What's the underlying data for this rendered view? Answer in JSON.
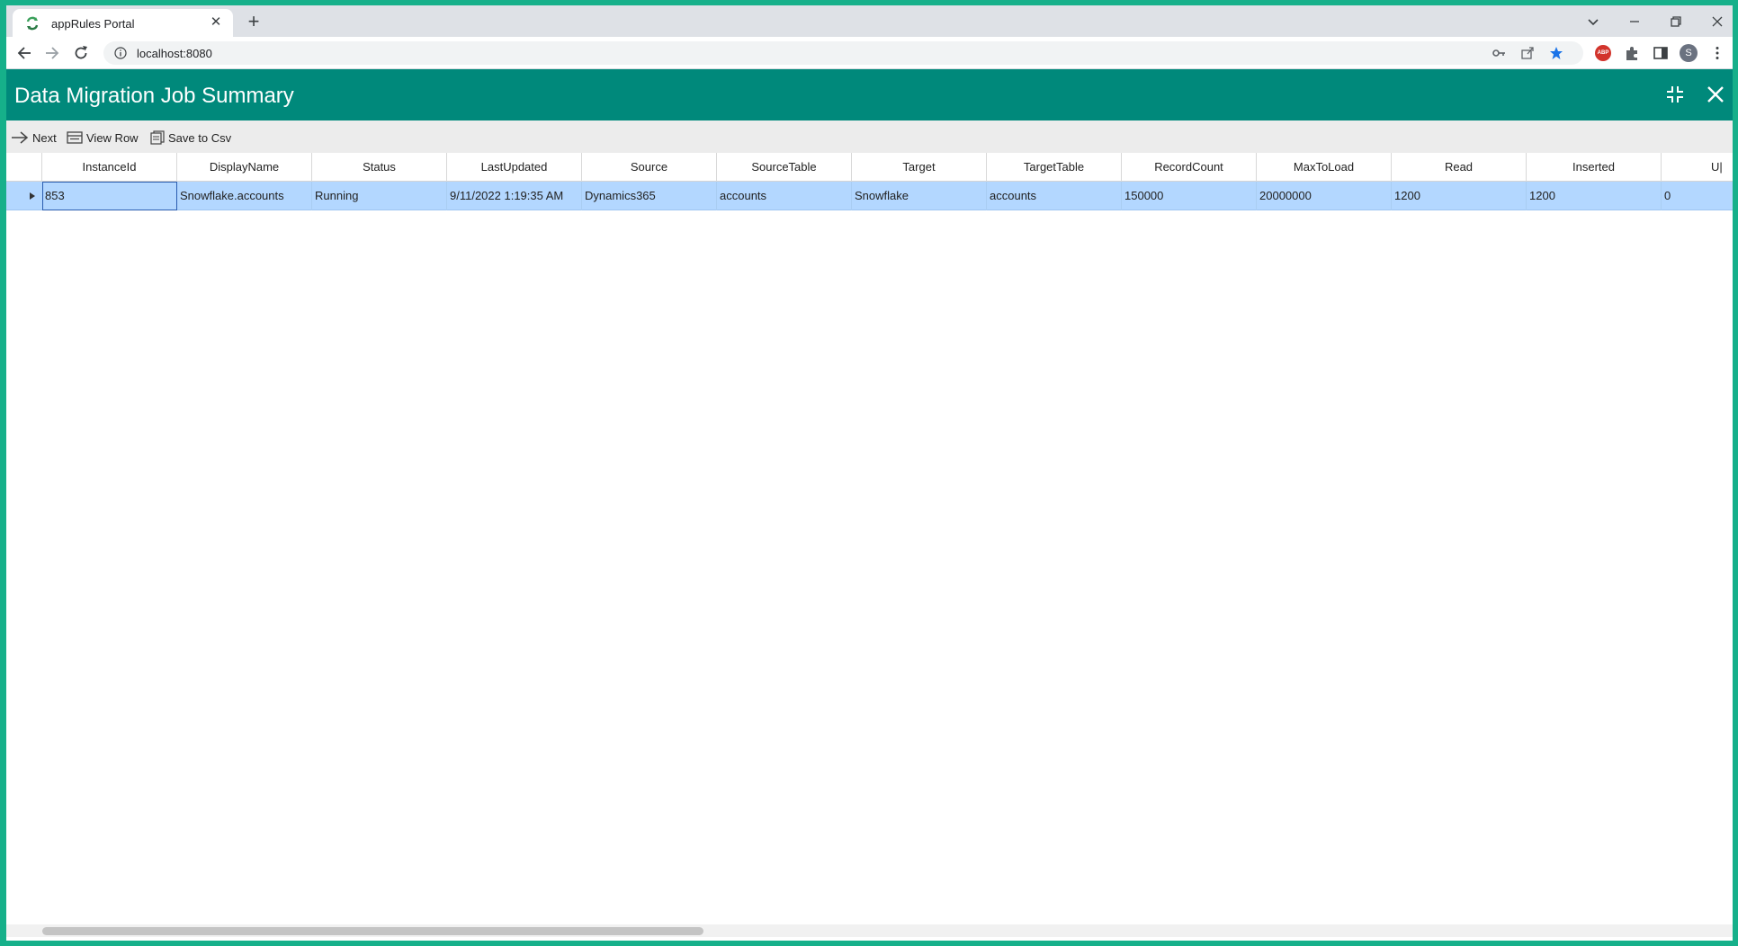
{
  "browser": {
    "tab_title": "appRules Portal",
    "url": "localhost:8080",
    "profile_initial": "S",
    "abp_label": "ABP",
    "new_tab_glyph": "+",
    "tab_close_glyph": "✕"
  },
  "app": {
    "title": "Data Migration Job Summary",
    "header_icons": [
      "collapse-icon",
      "close-icon"
    ],
    "accent_color": "#00897b"
  },
  "actions": {
    "next": "Next",
    "view_row": "View Row",
    "save_csv": "Save to Csv"
  },
  "grid": {
    "columns": [
      "InstanceId",
      "DisplayName",
      "Status",
      "LastUpdated",
      "Source",
      "SourceTable",
      "Target",
      "TargetTable",
      "RecordCount",
      "MaxToLoad",
      "Read",
      "Inserted",
      "U|"
    ],
    "rows": [
      [
        "853",
        "Snowflake.accounts",
        "Running",
        "9/11/2022 1:19:35 AM",
        "Dynamics365",
        "accounts",
        "Snowflake",
        "accounts",
        "150000",
        "20000000",
        "1200",
        "1200",
        "0"
      ]
    ],
    "selected_row_color": "#b3d7ff"
  }
}
